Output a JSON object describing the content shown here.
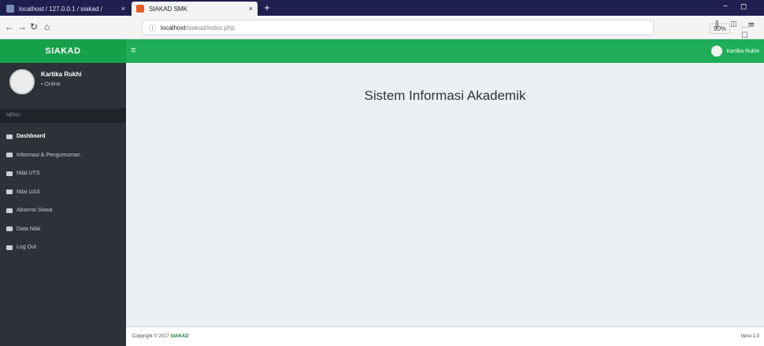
{
  "browser": {
    "tabs": [
      {
        "title": "localhost / 127.0.0.1 / siakad /",
        "active": false
      },
      {
        "title": "SIAKAD SMK",
        "active": true
      }
    ],
    "new_tab": "+",
    "url": {
      "host": "localhost",
      "path": "/siakad/index.php"
    },
    "zoom": "90%",
    "window_controls": {
      "minimize": "−",
      "maximize": "◻"
    }
  },
  "app": {
    "brand": "SIAKAD",
    "hamburger": "≡",
    "top_user": "Kartika Rukhi"
  },
  "sidebar": {
    "user": {
      "name": "Kartika Rukhi",
      "status": "• Online"
    },
    "header": "MENU",
    "items": [
      {
        "label": "Dashboard",
        "active": true
      },
      {
        "label": "Informasi & Pengumuman",
        "active": false
      },
      {
        "label": "Nilai UTS",
        "active": false
      },
      {
        "label": "Nilai UAS",
        "active": false
      },
      {
        "label": "Absensi Siswa",
        "active": false
      },
      {
        "label": "Data Nilai",
        "active": false
      },
      {
        "label": "Log Out",
        "active": false
      }
    ]
  },
  "content": {
    "title": "Sistem Informasi Akademik"
  },
  "footer": {
    "copyright": "Copyright © 2017",
    "brand": "SIAKAD",
    "right": "Versi 1.0"
  },
  "colors": {
    "topbar": "#1fae57",
    "sidebar": "#2c3237",
    "content_bg": "#ecf0f5"
  }
}
